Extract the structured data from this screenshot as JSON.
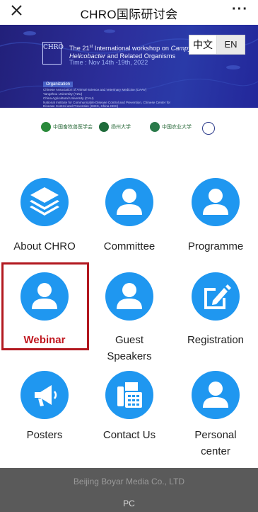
{
  "header": {
    "title": "CHRO国际研讨会",
    "more": "···"
  },
  "banner": {
    "logo_text": "CHRO",
    "workshop_line1_prefix": "The 21",
    "workshop_line1_sup": "st",
    "workshop_line1_suffix": " International workshop on ",
    "workshop_line1_italic": "Campylobacter,",
    "workshop_line2_italic": "Helicobacter",
    "workshop_line2_suffix": " and Related Organisms",
    "time": "Time : Nov 14th -19th, 2022",
    "organization_label": "Organization",
    "organizations": [
      "Chinese Association of Animal Science and Veterinary Medicine (CAAV)",
      "Yangzhou University (YZU)",
      "China Agricultural University (CAU)",
      "National Institute for Communicable Disease Control and Prevention, Chinese Center for",
      "Disease Control and Prevention  (ICDC, China CDC)"
    ]
  },
  "language": {
    "zh": "中文",
    "en": "EN"
  },
  "partners": [
    {
      "name": "中国畜牧兽医学会",
      "color": "#2a8a3a"
    },
    {
      "name": "扬州大学",
      "color": "#1f6b3a"
    },
    {
      "name": "中国农业大学",
      "color": "#2a7a4a"
    },
    {
      "name": "",
      "color": "#2b3a8a"
    }
  ],
  "menu": [
    {
      "label": "About CHRO",
      "icon": "layers-icon"
    },
    {
      "label": "Committee",
      "icon": "user-icon"
    },
    {
      "label": "Programme",
      "icon": "user-icon"
    },
    {
      "label": "Webinar",
      "icon": "user-icon"
    },
    {
      "label": "Guest Speakers",
      "label_line1": "Guest",
      "label_line2": "Speakers",
      "icon": "user-icon"
    },
    {
      "label": "Registration",
      "icon": "edit-icon"
    },
    {
      "label": "Posters",
      "icon": "megaphone-icon"
    },
    {
      "label": "Contact Us",
      "icon": "fax-phone-icon"
    },
    {
      "label": "Personal center",
      "label_line1": "Personal",
      "label_line2": "center",
      "icon": "user-circle-icon"
    }
  ],
  "footer": {
    "company": "Beijing Boyar Media Co., LTD",
    "pc": "PC"
  },
  "colors": {
    "accent_blue": "#1f97f0",
    "highlight_red": "#b2181f",
    "banner_dark": "#23279a",
    "footer_bg": "#5a5a5a"
  }
}
